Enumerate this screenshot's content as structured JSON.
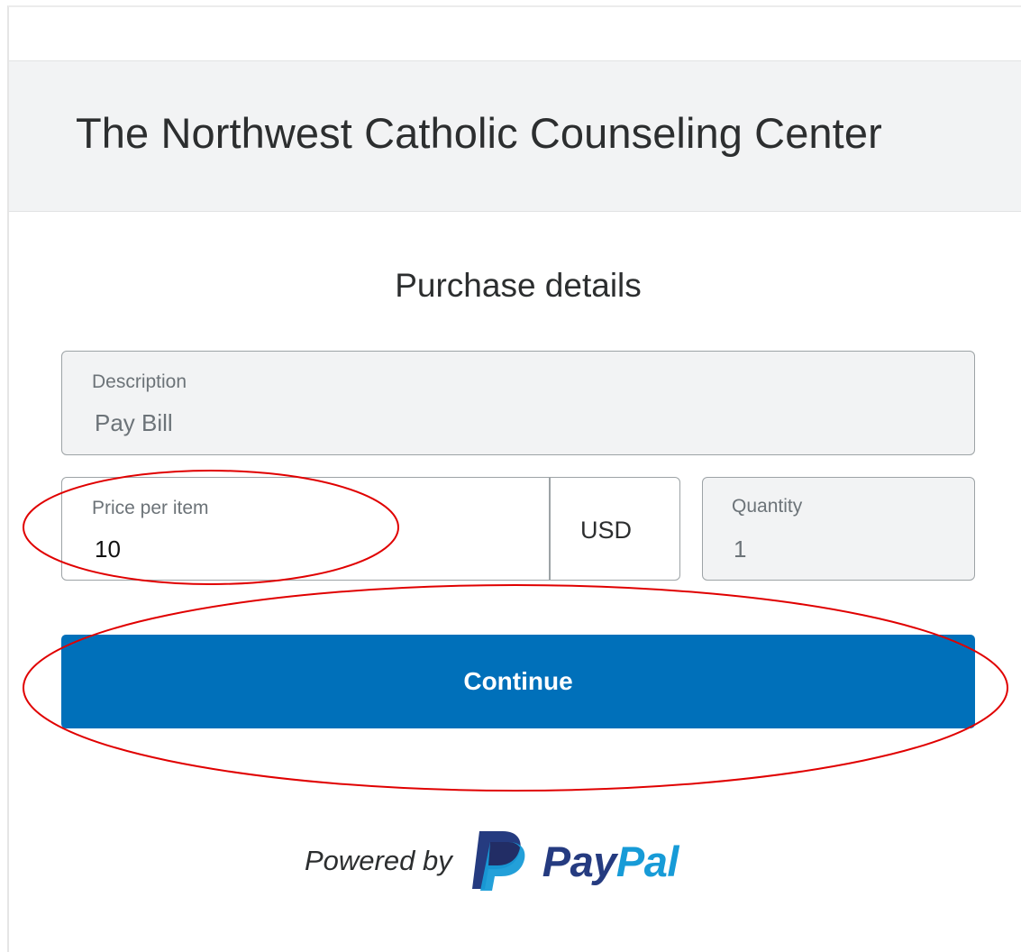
{
  "header": {
    "merchant_name": "The Northwest Catholic Counseling Center"
  },
  "form": {
    "title": "Purchase details",
    "description": {
      "label": "Description",
      "value": "Pay Bill"
    },
    "price": {
      "label": "Price per item",
      "value": "10",
      "currency": "USD"
    },
    "quantity": {
      "label": "Quantity",
      "value": "1"
    },
    "continue_label": "Continue"
  },
  "footer": {
    "powered_by": "Powered by",
    "brand_pay": "Pay",
    "brand_pal": "Pal",
    "logo_icon": "paypal-logo-icon"
  },
  "colors": {
    "primary_button": "#0070ba",
    "paypal_dark_blue": "#253b80",
    "paypal_light_blue": "#179bd7",
    "annotation_red": "#e00000",
    "header_band": "#f2f3f4"
  }
}
